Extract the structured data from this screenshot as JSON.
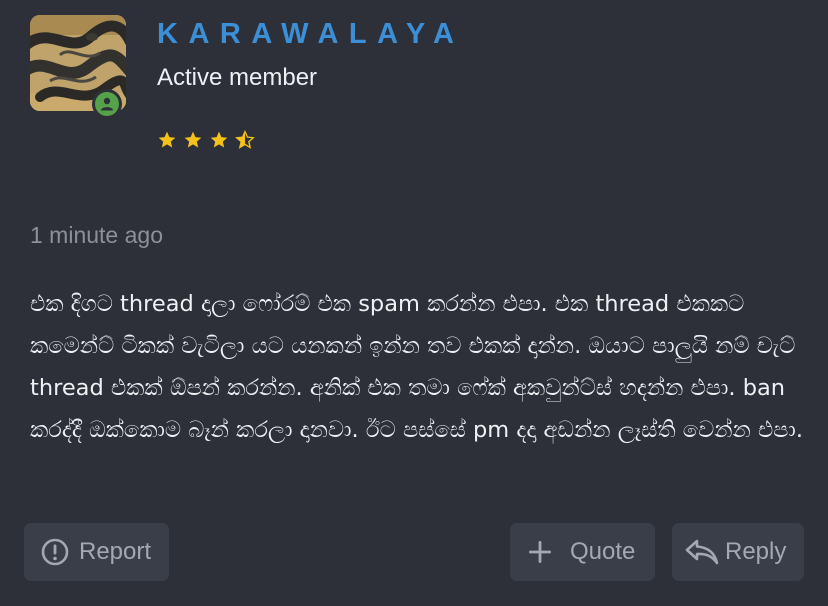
{
  "author": {
    "username": "KARAWALAYA",
    "title": "Active member",
    "avatar_icon": "snake-avatar",
    "online_indicator_icon": "user-online-icon",
    "rating_stars": 3.5,
    "rating_max": 4
  },
  "post": {
    "time": "1 minute ago",
    "body": "එක දිගට thread දාලා ෆෝරම් එක spam කරන්න එපා. එක thread එකකට කමෙන්ට් ටිකක් වැටිලා යට යනකන් ඉන්න තව එකක් දාන්න. ඔයාට පාලුයි නම් චැට් thread එකක් ඕපන් කරන්න. අනික් එක තමා ෆේක් අකවුන්ට්ස් හදන්න එපා. ban කරද්දී ඔක්කොම බෑන් කරලා දානවා. ඊට පස්සේ pm දදා අඩන්න ලෑස්ති වෙන්න එපා."
  },
  "actions": {
    "report": {
      "label": "Report",
      "icon": "alert-circle-icon"
    },
    "quote": {
      "label": "Quote",
      "icon": "plus-icon"
    },
    "reply": {
      "label": "Reply",
      "icon": "reply-arrow-icon"
    }
  },
  "colors": {
    "background": "#2d3039",
    "username": "#3b8fd6",
    "button_bg": "#3a3e49",
    "muted_text": "#8b909a",
    "star": "#f4c21b",
    "online": "#56a24a"
  }
}
